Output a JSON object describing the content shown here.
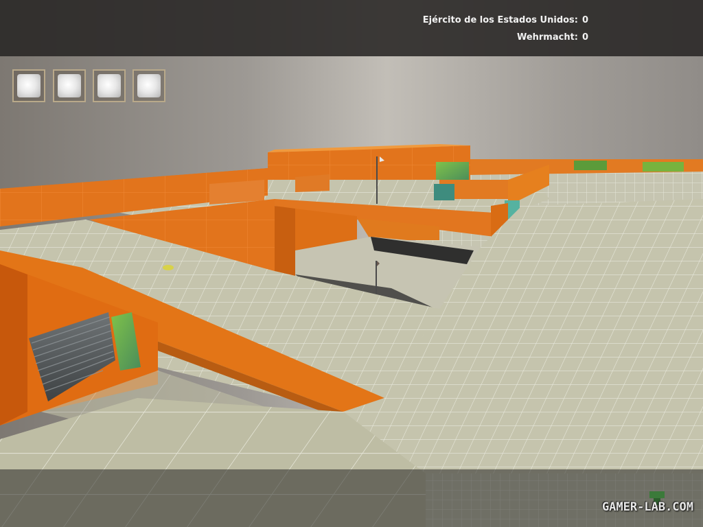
{
  "scoreboard": {
    "teams": [
      {
        "name": "Ejército de los Estados Unidos:",
        "score": "0"
      },
      {
        "name": "Wehrmacht:",
        "score": "0"
      }
    ]
  },
  "flags": [
    {
      "id": "flag-1",
      "state": "neutral"
    },
    {
      "id": "flag-2",
      "state": "neutral"
    },
    {
      "id": "flag-3",
      "state": "neutral"
    },
    {
      "id": "flag-4",
      "state": "neutral"
    }
  ],
  "watermark": {
    "text": "GAMER-LAB.COM"
  },
  "colors": {
    "wall_orange": "#e0731a",
    "floor": "#c9c8b4",
    "grid_line": "#e8e8dc",
    "sky": "#8d8a86",
    "hud_bar": "#282624"
  }
}
